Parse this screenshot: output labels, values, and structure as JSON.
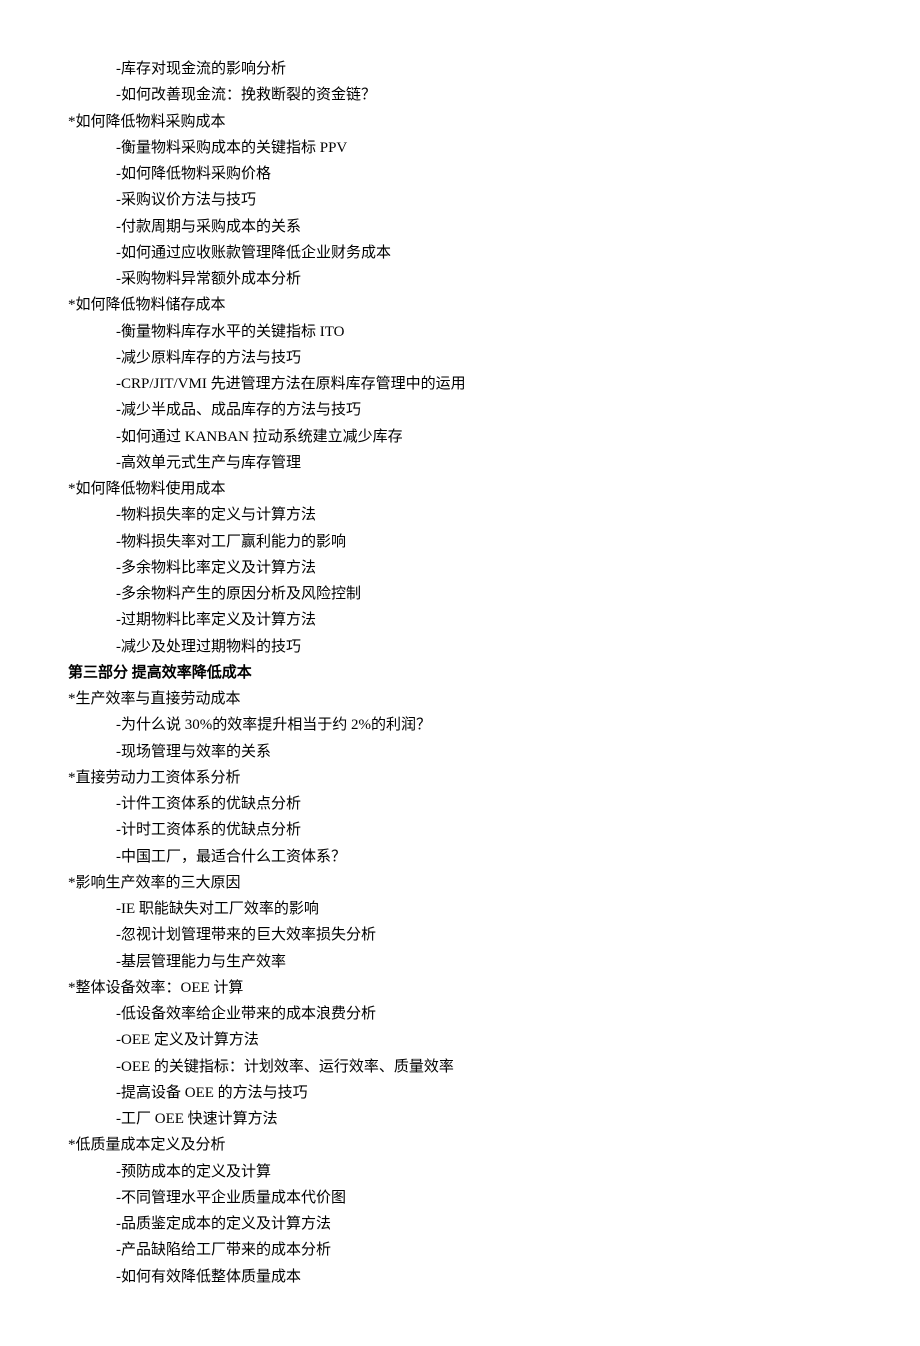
{
  "lines": [
    {
      "type": "sub",
      "text": "-库存对现金流的影响分析"
    },
    {
      "type": "sub",
      "text": "-如何改善现金流：挽救断裂的资金链？"
    },
    {
      "type": "topic",
      "text": "*如何降低物料采购成本"
    },
    {
      "type": "sub",
      "text": "-衡量物料采购成本的关键指标 PPV"
    },
    {
      "type": "sub",
      "text": "-如何降低物料采购价格"
    },
    {
      "type": "sub",
      "text": "-采购议价方法与技巧"
    },
    {
      "type": "sub",
      "text": "-付款周期与采购成本的关系"
    },
    {
      "type": "sub",
      "text": "-如何通过应收账款管理降低企业财务成本"
    },
    {
      "type": "sub",
      "text": "-采购物料异常额外成本分析"
    },
    {
      "type": "topic",
      "text": "*如何降低物料储存成本"
    },
    {
      "type": "sub",
      "text": "-衡量物料库存水平的关键指标 ITO"
    },
    {
      "type": "sub",
      "text": "-减少原料库存的方法与技巧"
    },
    {
      "type": "sub",
      "text": "-CRP/JIT/VMI 先进管理方法在原料库存管理中的运用"
    },
    {
      "type": "sub",
      "text": "-减少半成品、成品库存的方法与技巧"
    },
    {
      "type": "sub",
      "text": "-如何通过 KANBAN 拉动系统建立减少库存"
    },
    {
      "type": "sub",
      "text": "-高效单元式生产与库存管理"
    },
    {
      "type": "topic",
      "text": "*如何降低物料使用成本"
    },
    {
      "type": "sub",
      "text": "-物料损失率的定义与计算方法"
    },
    {
      "type": "sub",
      "text": "-物料损失率对工厂赢利能力的影响"
    },
    {
      "type": "sub",
      "text": "-多余物料比率定义及计算方法"
    },
    {
      "type": "sub",
      "text": "-多余物料产生的原因分析及风险控制"
    },
    {
      "type": "sub",
      "text": "-过期物料比率定义及计算方法"
    },
    {
      "type": "sub",
      "text": "-减少及处理过期物料的技巧"
    },
    {
      "type": "section",
      "text": "第三部分 提高效率降低成本"
    },
    {
      "type": "topic",
      "text": "*生产效率与直接劳动成本"
    },
    {
      "type": "sub",
      "text": "-为什么说 30%的效率提升相当于约 2%的利润？"
    },
    {
      "type": "sub",
      "text": "-现场管理与效率的关系"
    },
    {
      "type": "topic",
      "text": "*直接劳动力工资体系分析"
    },
    {
      "type": "sub",
      "text": "-计件工资体系的优缺点分析"
    },
    {
      "type": "sub",
      "text": "-计时工资体系的优缺点分析"
    },
    {
      "type": "sub",
      "text": "-中国工厂，最适合什么工资体系？"
    },
    {
      "type": "topic",
      "text": "*影响生产效率的三大原因"
    },
    {
      "type": "sub",
      "text": "-IE 职能缺失对工厂效率的影响"
    },
    {
      "type": "sub",
      "text": "-忽视计划管理带来的巨大效率损失分析"
    },
    {
      "type": "sub",
      "text": "-基层管理能力与生产效率"
    },
    {
      "type": "topic",
      "text": "*整体设备效率：OEE 计算"
    },
    {
      "type": "sub",
      "text": "-低设备效率给企业带来的成本浪费分析"
    },
    {
      "type": "sub",
      "text": "-OEE 定义及计算方法"
    },
    {
      "type": "sub",
      "text": "-OEE 的关键指标：计划效率、运行效率、质量效率"
    },
    {
      "type": "sub",
      "text": "-提高设备 OEE 的方法与技巧"
    },
    {
      "type": "sub",
      "text": "-工厂 OEE 快速计算方法"
    },
    {
      "type": "topic",
      "text": "*低质量成本定义及分析"
    },
    {
      "type": "sub",
      "text": "-预防成本的定义及计算"
    },
    {
      "type": "sub",
      "text": "-不同管理水平企业质量成本代价图"
    },
    {
      "type": "sub",
      "text": "-品质鉴定成本的定义及计算方法"
    },
    {
      "type": "sub",
      "text": "-产品缺陷给工厂带来的成本分析"
    },
    {
      "type": "sub",
      "text": "-如何有效降低整体质量成本"
    }
  ]
}
